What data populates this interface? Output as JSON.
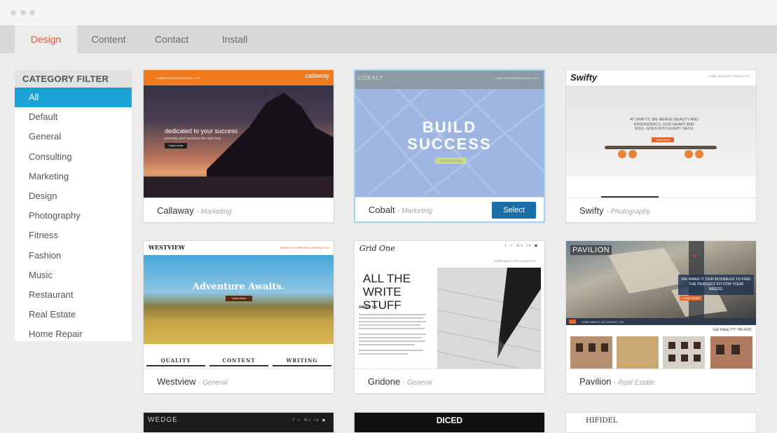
{
  "tabs": [
    "Design",
    "Content",
    "Contact",
    "Install"
  ],
  "sidebar": {
    "title": "CATEGORY FILTER",
    "items": [
      "All",
      "Default",
      "General",
      "Consulting",
      "Marketing",
      "Design",
      "Photography",
      "Fitness",
      "Fashion",
      "Music",
      "Restaurant",
      "Real Estate",
      "Home Repair"
    ]
  },
  "select_label": "Select",
  "cards": [
    {
      "name": "Callaway",
      "category": "- Marketing",
      "thumb": {
        "brand": "callaway",
        "nav": "HOME  OUR WORK  CONTACT US",
        "headline": "dedicated to your success",
        "sub": "promote your business the right way",
        "btn": "Learn more"
      }
    },
    {
      "name": "Cobalt",
      "category": "- Marketing",
      "thumb": {
        "brand": "COBALT",
        "nav": "HOME  OUR WORK  CONTACT US",
        "headline1": "BUILD",
        "headline2": "SUCCESS",
        "btn": "SEE OUR WORK"
      }
    },
    {
      "name": "Swifty",
      "category": "- Photography",
      "thumb": {
        "brand": "Swifty",
        "nav": "HOME  GALLERY  CONTACT US",
        "text": "AT SWIFTY, WE MERGE BEAUTY AND ERGONOMICS. OUR HEART AND SOUL GOES INTO EVERY DECK.",
        "btn": "Learn More"
      }
    },
    {
      "name": "Westview",
      "category": "- General",
      "thumb": {
        "brand": "WESTVIEW",
        "nav": "HOME  OUR SERVICES  CONTACT US",
        "headline": "Adventure Awaits.",
        "btn": "Learn More",
        "cols": [
          "QUALITY",
          "CONTENT",
          "WRITING"
        ]
      }
    },
    {
      "name": "Gridone",
      "category": "- General",
      "thumb": {
        "brand": "Grid One",
        "nav": "HOME  ABOUT US  CONTACT US",
        "headline": "ALL THE WRITE STUFF",
        "about": "ABOUT US"
      }
    },
    {
      "name": "Pavilion",
      "category": "- Real Estate",
      "thumb": {
        "brand": "PAVILION",
        "text": "WE MAKE IT OUR BUSINESS TO FIND THE PERFECT FIT FOR YOUR NEEDS.",
        "btn": "LEARN MORE",
        "nav": "HOME  ABOUT US  CONTACT US",
        "phone": "Call Today 777-765-4321"
      }
    },
    {
      "name": "",
      "category": "",
      "thumb": {
        "brand": "WEDGE"
      }
    },
    {
      "name": "",
      "category": "",
      "thumb": {
        "brand": "DICED"
      }
    },
    {
      "name": "",
      "category": "",
      "thumb": {
        "brand": "HIFIDEL"
      }
    }
  ],
  "colors": {
    "accent": "#e8572a",
    "active": "#1aa2d6",
    "select": "#1b6fa8"
  }
}
